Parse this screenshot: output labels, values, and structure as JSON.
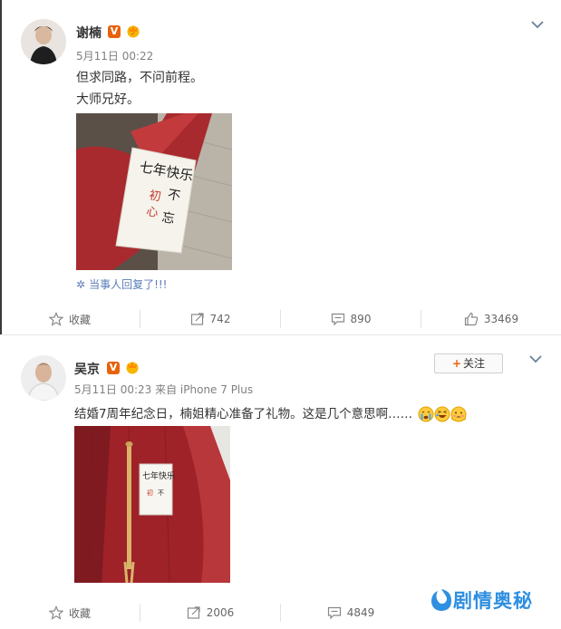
{
  "posts": [
    {
      "author": "谢楠",
      "time": "5月11日 00:22",
      "source": "",
      "lines": [
        "但求同路，不问前程。",
        "大师兄好。"
      ],
      "note_text": [
        "七年快乐",
        "初",
        "不",
        "忘",
        "心"
      ],
      "reply_text": "当事人回复了!!!",
      "actions": {
        "favorite": "收藏",
        "repost": "742",
        "comment": "890",
        "like": "33469"
      }
    },
    {
      "author": "吴京",
      "time": "5月11日 00:23 来自 iPhone 7 Plus",
      "follow_label": "关注",
      "text": "结婚7周年纪念日，楠姐精心准备了礼物。这是几个意思啊……",
      "emojis": [
        "crying-face",
        "laughing-face",
        "embarrassed-face"
      ],
      "actions": {
        "favorite": "收藏",
        "repost": "2006",
        "comment": "4849"
      }
    }
  ],
  "watermark": "剧情奥秘",
  "colors": {
    "verified_badge": "#e8620b",
    "link": "#5a7cb8",
    "watermark": "#2f8fe0"
  }
}
